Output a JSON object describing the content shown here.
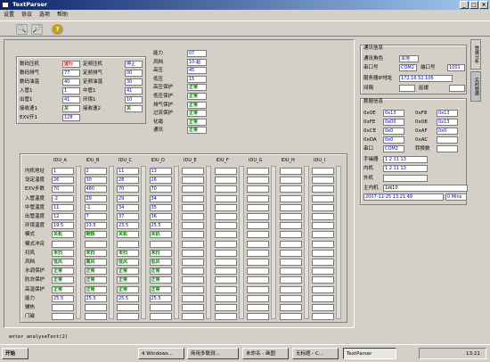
{
  "window": {
    "title": "TextParser",
    "min": "_",
    "max": "□",
    "close": "×"
  },
  "menu": [
    "设置",
    "协议",
    "选项",
    "帮助"
  ],
  "left_panel": {
    "rows": [
      {
        "label": "数码压机",
        "value": "运行",
        "label2": "定频压机",
        "value2": "停止"
      },
      {
        "label": "数码排气",
        "value": "77",
        "label2": "定频排气",
        "value2": "00"
      },
      {
        "label": "数码油温",
        "value": "40",
        "label2": "定频油温",
        "value2": "30"
      },
      {
        "label": "入管1",
        "value": "1",
        "label2": "中管1",
        "value2": "41"
      },
      {
        "label": "出管1",
        "value": "41",
        "label2": "环境1",
        "value2": "10"
      },
      {
        "label": "接收速1",
        "value": "关",
        "label2": "接收速2",
        "value2": "关"
      },
      {
        "label": "EXV开1",
        "value": "128",
        "label2": "",
        "value2": ""
      }
    ]
  },
  "mid_panel": {
    "rows": [
      {
        "label": "能力",
        "value": "07"
      },
      {
        "label": "风档",
        "value": "10-超"
      },
      {
        "label": "高压",
        "value": "45"
      },
      {
        "label": "低压",
        "value": "15"
      },
      {
        "label": "高压保护",
        "value": "正常"
      },
      {
        "label": "低压保护",
        "value": "正常"
      },
      {
        "label": "排气保护",
        "value": "正常"
      },
      {
        "label": "过流保护",
        "value": "正常"
      },
      {
        "label": "化霜",
        "value": "正常"
      },
      {
        "label": "通讯",
        "value": "正常"
      }
    ]
  },
  "comm": {
    "title": "通讯信息",
    "role_label": "通讯角色",
    "role_value": "本地",
    "port_label": "串口号",
    "port_value": "COM2",
    "port2_label": "端口号",
    "port2_value": "1001",
    "ip_label": "服务器IP地址",
    "ip_value": "172.16.52.106",
    "interval_label": "间隔",
    "delay_label": "延缓"
  },
  "data_info": {
    "title": "数据信息",
    "rows": [
      {
        "l1": "0x0E",
        "v1": "0x13",
        "l2": "0xF8",
        "v2": "0x13"
      },
      {
        "l1": "0xFE",
        "v1": "0x00",
        "l2": "0x08",
        "v2": "0x13"
      },
      {
        "l1": "0xCE",
        "v1": "0x0",
        "l2": "0xAF",
        "v2": "0x0"
      },
      {
        "l1": "0xDA",
        "v1": "0x0",
        "l2": "0xAC",
        "v2": ""
      },
      {
        "l1": "串口",
        "v1": "COM2",
        "l2": "转换数",
        "v2": ""
      }
    ],
    "hand_label": "手操器",
    "hand_value": "1  2  11  13",
    "inner_label": "内机",
    "inner_value": "1  2  11  13",
    "outer_label": "外机",
    "outer_value": "",
    "host_label": "主内机",
    "host_value": "1阀10",
    "time_value": "2007-12-25 13:21:49",
    "mins_value": "0 Mins"
  },
  "side_tabs": [
    "数据分析",
    "实时数据"
  ],
  "units": {
    "row_labels": [
      "内机地址",
      "设定温度",
      "EXV步数",
      "入管温度",
      "中管温度",
      "出管温度",
      "环境温度",
      "模式",
      "模式冲突",
      "扫风",
      "风档",
      "水调保护",
      "防冻保护",
      "高温保护",
      "能力",
      "辅热",
      "门磁"
    ],
    "columns": [
      {
        "name": "IDU_A",
        "values": [
          "1",
          "26",
          "70",
          "-2",
          "11",
          "12",
          "19.5",
          "关机",
          "",
          "未扫",
          "低风",
          "正常",
          "正常",
          "正常",
          "25.5",
          "",
          ""
        ]
      },
      {
        "name": "IDU_B",
        "values": [
          "2",
          "30",
          "480",
          "29",
          "-1",
          "7",
          "23.5",
          "制热",
          "",
          "未扫",
          "高风",
          "正常",
          "正常",
          "正常",
          "25.5",
          "",
          ""
        ]
      },
      {
        "name": "IDU_C",
        "values": [
          "11",
          "28",
          "70",
          "29",
          "34",
          "37",
          "23.5",
          "关机",
          "",
          "未扫",
          "低风",
          "正常",
          "正常",
          "正常",
          "25.5",
          "",
          ""
        ]
      },
      {
        "name": "IDU_D",
        "values": [
          "13",
          "26",
          "70",
          "34",
          "35",
          "36",
          "25.5",
          "关机",
          "",
          "未扫",
          "低风",
          "正常",
          "正常",
          "正常",
          "25.5",
          "",
          ""
        ]
      },
      {
        "name": "IDU_E",
        "values": [
          "",
          "",
          "",
          "",
          "",
          "",
          "",
          "",
          "",
          "",
          "",
          "",
          "",
          "",
          "",
          "",
          ""
        ]
      },
      {
        "name": "IDU_F",
        "values": [
          "",
          "",
          "",
          "",
          "",
          "",
          "",
          "",
          "",
          "",
          "",
          "",
          "",
          "",
          "",
          "",
          ""
        ]
      },
      {
        "name": "IDU_G",
        "values": [
          "",
          "",
          "",
          "",
          "",
          "",
          "",
          "",
          "",
          "",
          "",
          "",
          "",
          "",
          "",
          "",
          ""
        ]
      },
      {
        "name": "IDU_H",
        "values": [
          "",
          "",
          "",
          "",
          "",
          "",
          "",
          "",
          "",
          "",
          "",
          "",
          "",
          "",
          "",
          "",
          ""
        ]
      },
      {
        "name": "IDU_I",
        "values": [
          "",
          "",
          "",
          "",
          "",
          "",
          "",
          "",
          "",
          "",
          "",
          "",
          "",
          "",
          "",
          "",
          ""
        ]
      }
    ]
  },
  "status_line": "enter analyseText(2)",
  "taskbar": {
    "start": "开始",
    "tasks": [
      "4 Windows...",
      "商用多联测...",
      "未命名 - 画图",
      "无标题 - C...",
      "TextParser"
    ],
    "clock": "13:21"
  }
}
